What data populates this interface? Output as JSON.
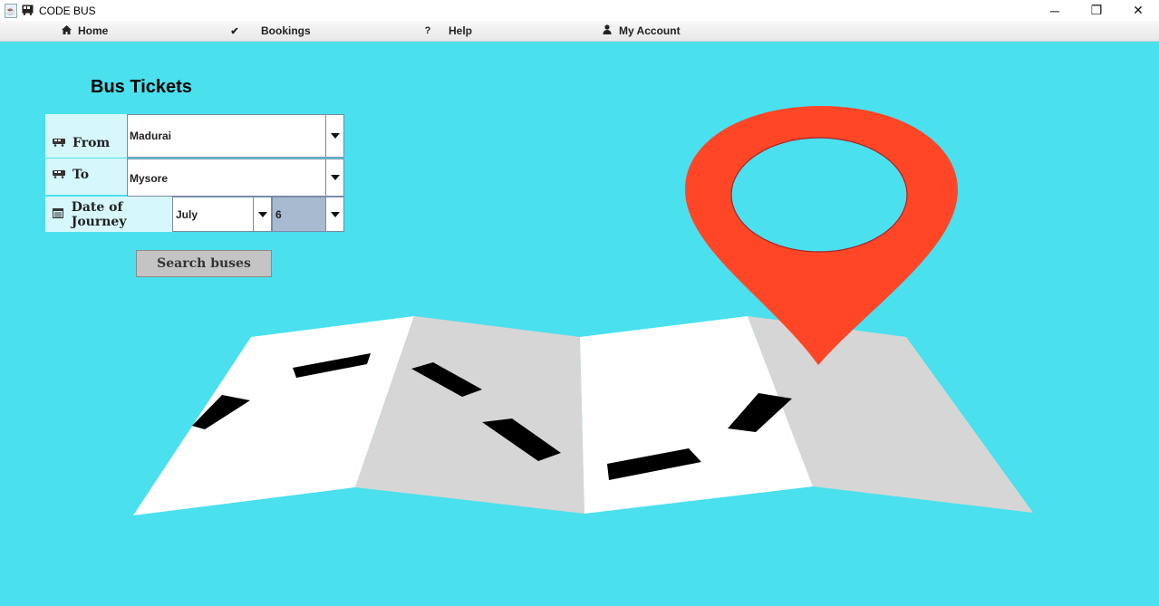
{
  "window": {
    "title": "CODE BUS"
  },
  "menubar": {
    "items": [
      {
        "label": "Home",
        "icon": "home-icon"
      },
      {
        "label": "Bookings",
        "icon": "check-icon"
      },
      {
        "label": "Help",
        "icon": "question-icon"
      },
      {
        "label": "My Account",
        "icon": "user-icon"
      }
    ]
  },
  "form": {
    "heading": "Bus Tickets",
    "from": {
      "label": "From",
      "value": "Madurai"
    },
    "to": {
      "label": "To",
      "value": "Mysore"
    },
    "date": {
      "label": "Date of Journey",
      "month": "July",
      "day": "6"
    },
    "search_label": "Search buses"
  },
  "colors": {
    "background": "#4ae0ee",
    "label_background": "#d6f8fc",
    "pin": "#ff4627",
    "map_light": "#ffffff",
    "map_dark": "#d6d6d6"
  }
}
